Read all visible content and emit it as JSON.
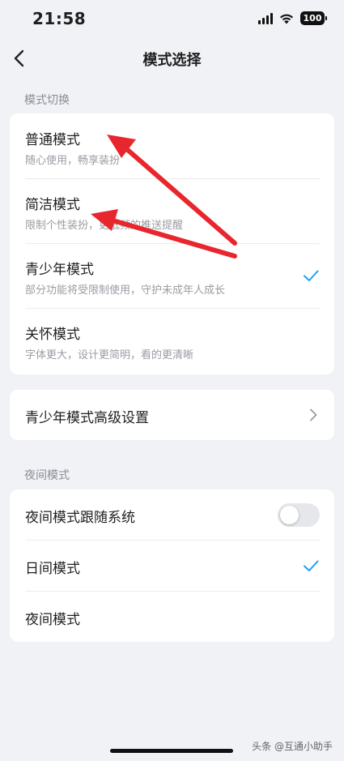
{
  "status_bar": {
    "time": "21:58",
    "battery": "100"
  },
  "nav": {
    "title": "模式选择",
    "back_icon": "chevron-left-icon"
  },
  "mode_section": {
    "title": "模式切换",
    "items": [
      {
        "title": "普通模式",
        "subtitle": "随心使用，畅享装扮",
        "selected": false
      },
      {
        "title": "简洁模式",
        "subtitle": "限制个性装扮，更低频的推送提醒",
        "selected": false
      },
      {
        "title": "青少年模式",
        "subtitle": "部分功能将受限制使用，守护未成年人成长",
        "selected": true
      },
      {
        "title": "关怀模式",
        "subtitle": "字体更大，设计更简明，看的更清晰",
        "selected": false
      }
    ]
  },
  "teen_settings": {
    "label": "青少年模式高级设置"
  },
  "night_section": {
    "title": "夜间模式",
    "follow_system": {
      "label": "夜间模式跟随系统",
      "on": false
    },
    "items": [
      {
        "title": "日间模式",
        "selected": true
      },
      {
        "title": "夜间模式",
        "selected": false
      }
    ]
  },
  "watermark": "头条 @互通小助手",
  "colors": {
    "accent": "#1e9ff2",
    "background": "#f1f2f6",
    "annotation_arrow": "#e8262e"
  }
}
